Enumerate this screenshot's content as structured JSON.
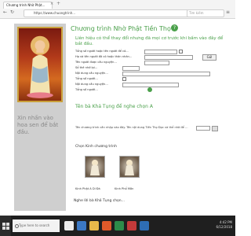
{
  "browser": {
    "tab_title": "Chương trình Nhờ Phật...",
    "tab_close": "×",
    "new_tab": "+",
    "url": "https://www.chuongtrinh...",
    "search_placeholder": "Tìm kiếm"
  },
  "left": {
    "caption": "Xin nhấn vào hoa sen để bắt đầu."
  },
  "main": {
    "title": "Chương trình Nhờ Phật Tiền Thọ",
    "help_label": "?",
    "intro": "Liên hiệu có thể thay đổi nhưng đã mọi cơ trước khi bấm vào đây để bắt đầu.",
    "form": {
      "row1_label": "Tổng số người hoặc tên người để có...",
      "row2_label": "Họ và tên người đã có hoặc thân nhân...",
      "row3_label": "Tên người được cầu nguyện...",
      "row4_label": "Sổ thẻ nhớ lại...",
      "row5_label": "Nội dung cầu nguyện...",
      "row6_label": "Tổng số người...",
      "send_label": "Gửi"
    },
    "section1": "Tên bà Khả Tụng để nghe chọn A",
    "field_line": "Tên chương trình cần nhập vào đây. Tên nội dung Tiền Thọ Đọc và thể nhờ để ...",
    "section2": "Chọn Kinh chương trình",
    "captions": [
      "Kinh Phật A Di Đà",
      "Kinh Phổ Môn"
    ],
    "section3": "Nghe lời bà Khả Tụng chọn..."
  },
  "taskbar": {
    "search_placeholder": "Type here to search",
    "time": "4:42 PM",
    "date": "6/12/2018"
  },
  "colors": {
    "accent_green": "#4aa04a",
    "sidebar_gray": "#cfcfcf",
    "taskbar": "#1f1f1f"
  }
}
